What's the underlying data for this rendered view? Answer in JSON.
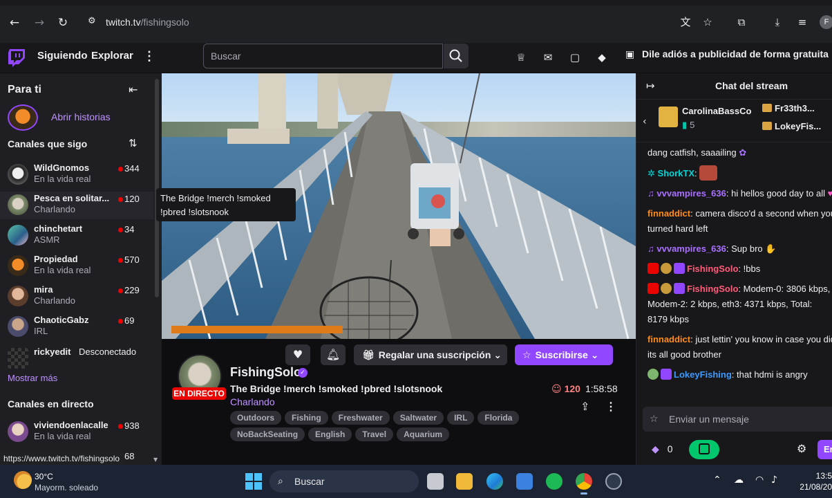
{
  "browser": {
    "url_domain": "twitch.tv",
    "url_path": "/fishingsolo",
    "profile_initial": "F"
  },
  "topnav": {
    "following": "Siguiendo",
    "browse": "Explorar",
    "search_placeholder": "Buscar",
    "ad_free": "Dile adiós a publicidad de forma gratuita"
  },
  "sidebar": {
    "title": "Para ti",
    "stories_label": "Abrir historias",
    "followed_title": "Canales que sigo",
    "show_more": "Mostrar más",
    "live_title": "Canales en directo",
    "channels": [
      {
        "name": "WildGnomos",
        "category": "En la vida real",
        "viewers": "344"
      },
      {
        "name": "Pesca en solitar...",
        "category": "Charlando",
        "viewers": "120"
      },
      {
        "name": "chinchetart",
        "category": "ASMR",
        "viewers": "34"
      },
      {
        "name": "Propiedad",
        "category": "En la vida real",
        "viewers": "570"
      },
      {
        "name": "mira",
        "category": "Charlando",
        "viewers": "229"
      },
      {
        "name": "ChaoticGabz",
        "category": "IRL",
        "viewers": "69"
      },
      {
        "name": "rickyedit",
        "status": "Desconectado"
      }
    ],
    "live_channels": [
      {
        "name": "viviendoenlacalle",
        "category": "En la vida real",
        "viewers": "938"
      },
      {
        "viewers": "68"
      }
    ]
  },
  "tooltip": "The Bridge !merch !smoked !pbred !slotsnook",
  "stream": {
    "gift_label": "Regalar una suscripción",
    "subscribe_label": "Suscribirse",
    "live_badge": "EN DIRECTO",
    "streamer": "FishingSolo",
    "title": "The Bridge !merch !smoked !pbred !slotsnook",
    "category": "Charlando",
    "viewers": "120",
    "uptime": "1:58:58",
    "tags": [
      "Outdoors",
      "Fishing",
      "Freshwater",
      "Saltwater",
      "IRL",
      "Florida",
      "NoBackSeating",
      "English",
      "Travel",
      "Aquarium"
    ]
  },
  "chat": {
    "title": "Chat del stream",
    "top_gifter": "CarolinaBassCo",
    "top_gifter_count": "5",
    "gifters": [
      "Fr33th3...",
      "LokeyFis..."
    ],
    "messages": [
      {
        "user": "",
        "text": "dang catfish, saaailing",
        "color": "#efeff1"
      },
      {
        "user": "ShorkTX",
        "text": "",
        "color": "#00d6d6"
      },
      {
        "user": "vvvampires_636",
        "text": "hi hellos good day to all",
        "color": "#a970ff"
      },
      {
        "user": "finnaddict",
        "text": "camera disco'd a second when you turned hard left",
        "color": "#ff8c1a"
      },
      {
        "user": "vvvampires_636",
        "text": "Sup bro",
        "color": "#a970ff"
      },
      {
        "user": "FishingSolo",
        "text": "!bbs",
        "color": "#ff5c7a"
      },
      {
        "user": "FishingSolo",
        "text": "Modem-0: 3806 kbps, Modem-2: 2 kbps, eth3: 4371 kbps, Total: 8179 kbps",
        "color": "#ff5c7a"
      },
      {
        "user": "finnaddict",
        "text": "just lettin' you know in case you didn't its all good brother",
        "color": "#ff8c1a"
      },
      {
        "user": "LokeyFishing",
        "text": "that hdmi is angry",
        "color": "#3d9bff"
      }
    ],
    "input_placeholder": "Enviar un mensaje",
    "bits": "0",
    "send_label": "Enviar"
  },
  "status_url": "https://www.twitch.tv/fishingsolo",
  "taskbar": {
    "temp": "30°C",
    "weather": "Mayorm. soleado",
    "search": "Buscar",
    "time": "13:5",
    "date": "21/08/20"
  },
  "colors": {
    "accent": "#9147ff",
    "live": "#eb0400"
  }
}
